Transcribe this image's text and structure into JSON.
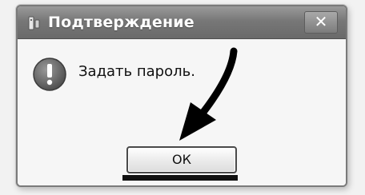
{
  "window": {
    "title": "Подтверждение",
    "close_label": "✕"
  },
  "message": {
    "text": "Задать пароль."
  },
  "buttons": {
    "ok_label": "ОК"
  },
  "icons": {
    "title": "key-icon",
    "message": "exclamation-icon"
  }
}
